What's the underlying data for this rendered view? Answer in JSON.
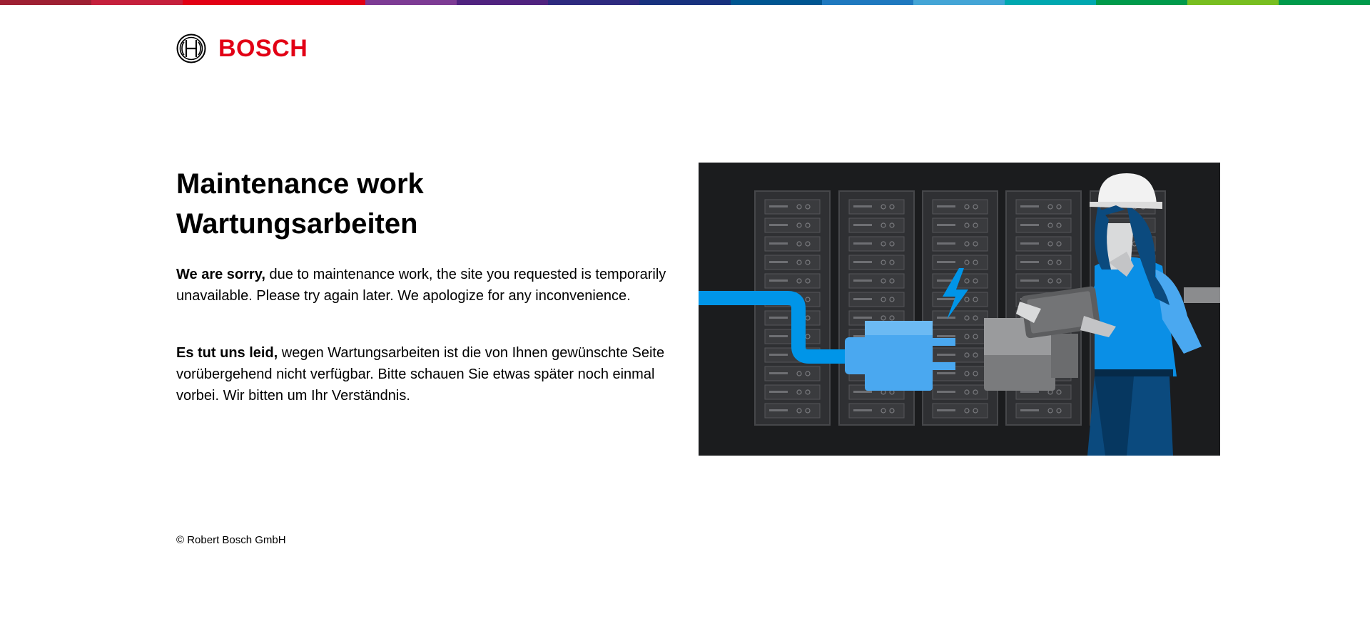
{
  "brand": {
    "name": "BOSCH",
    "color": "#e20015",
    "logo_icon": "bosch-armature-icon"
  },
  "supergraphic_colors": [
    "#9e2033",
    "#c5203c",
    "#e20015",
    "#e20015",
    "#7d3b94",
    "#50237f",
    "#2e2a7f",
    "#18327e",
    "#005691",
    "#1f79bf",
    "#44a5d6",
    "#00a8b0",
    "#009a4b",
    "#78be20",
    "#009a4b"
  ],
  "headline": {
    "en": "Maintenance work",
    "de": "Wartungsarbeiten"
  },
  "message_en": {
    "lead": "We are sorry,",
    "body": " due to maintenance work, the site you requested is temporarily unavailable. Please try again later. We apologize for any inconvenience."
  },
  "message_de": {
    "lead": "Es tut uns leid,",
    "body": " wegen Wartungsarbeiten ist die von Ihnen gewünschte Seite vorübergehend nicht verfügbar. Bitte schauen Sie etwas später noch einmal vorbei. Wir bitten um Ihr Verständnis."
  },
  "illustration": {
    "icon": "server-rack-maintenance-illustration",
    "colors": {
      "background": "#1b1c1e",
      "rack": "#2f3033",
      "cable_blue": "#0095e8",
      "plug_blue": "#4aa8f0",
      "plug_gray": "#7a7b7d",
      "worker_shirt": "#0a8fe6",
      "worker_pants": "#0b4a7e"
    }
  },
  "footer": {
    "copyright": "© Robert Bosch GmbH"
  }
}
